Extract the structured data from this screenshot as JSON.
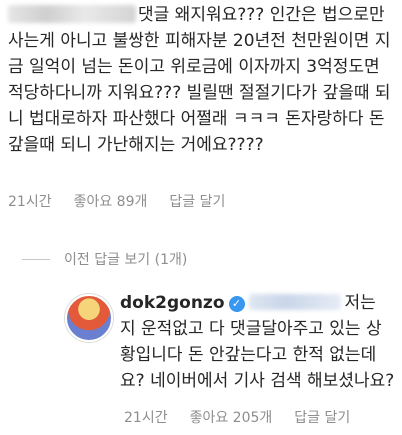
{
  "top_comment": {
    "text": "댓글 왜지워요??? 인간은 법으로만 사는게 아니고 불쌍한 피해자분 20년전 천만원이면 지금 일억이 넘는 돈이고 위로금에 이자까지 3억정도면 적당하다니까 지워요??? 빌릴땐 절절기다가 갚을때 되니 법대로하자 파산했다 어쩔래 ㅋㅋㅋ 돈자랑하다 돈갚을때 되니 가난해지는 거에요????",
    "time": "21시간",
    "likes": "좋아요 89개",
    "reply": "답글 달기"
  },
  "view_previous": "이전 답글 보기 (1개)",
  "reply_comment": {
    "username": "dok2gonzo",
    "verified_icon": "✓",
    "text": "저는 지 운적없고 다 댓글달아주고 있는 상황입니다 돈 안갚는다고 한적 없는데요? 네이버에서 기사 검색 해보셨나요?",
    "time": "21시간",
    "likes": "좋아요 205개",
    "reply": "답글 달기"
  }
}
